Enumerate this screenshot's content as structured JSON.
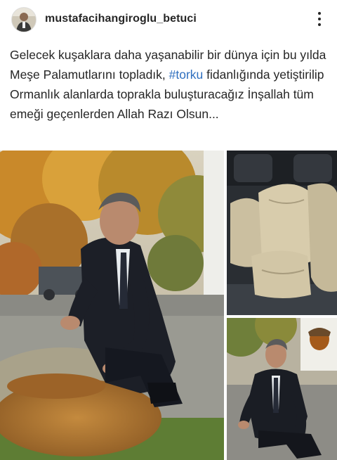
{
  "post": {
    "username": "mustafacihangiroglu_betuci",
    "caption_part1": "Gelecek kuşaklara daha yaşanabilir bir dünya için bu yılda Meşe Palamutlarını topladık, ",
    "hashtag": "#torku",
    "caption_part2": " fidanlığında yetiştirilip Ormanlık alanlarda toprakla buluşturacağız İnşallah tüm emeği geçenlerden Allah Razı Olsun..."
  },
  "icons": {
    "avatar": "profile-avatar",
    "more": "more-options-icon"
  },
  "colors": {
    "text": "#262626",
    "hashtag": "#2f6fbf",
    "background": "#ffffff"
  }
}
